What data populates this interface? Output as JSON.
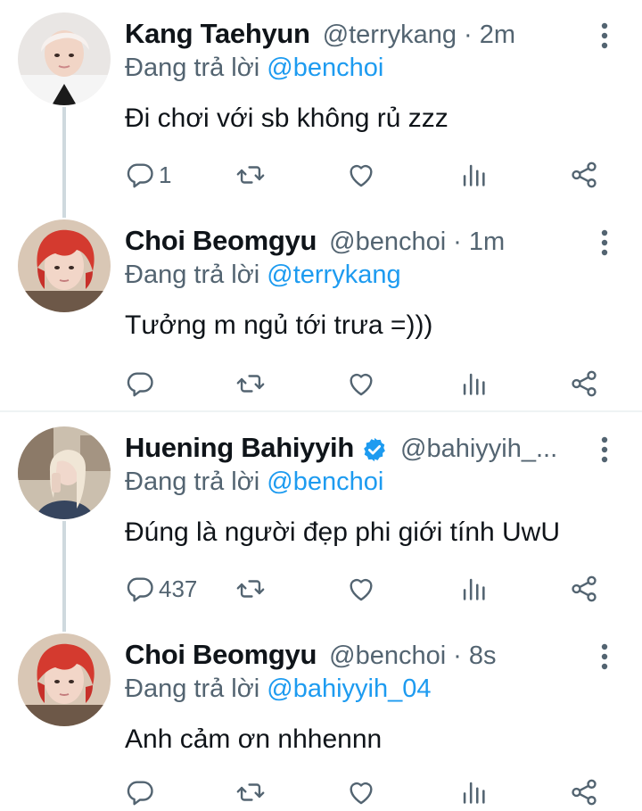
{
  "tweets": [
    {
      "name": "Kang Taehyun",
      "handle": "@terrykang",
      "time": "2m",
      "verified": false,
      "reply_prefix": "Đang trả lời",
      "reply_to": "@benchoi",
      "text": "Đi chơi với sb không rủ zzz",
      "reply_count": "1",
      "avatar": "avatar-white-hair"
    },
    {
      "name": "Choi Beomgyu",
      "handle": "@benchoi",
      "time": "1m",
      "verified": false,
      "reply_prefix": "Đang trả lời",
      "reply_to": "@terrykang",
      "text": "Tưởng m ngủ tới trưa =)))",
      "reply_count": "",
      "avatar": "avatar-red-hair"
    },
    {
      "name": "Huening Bahiyyih",
      "handle": "@bahiyyih_...",
      "time": "",
      "verified": true,
      "reply_prefix": "Đang trả lời",
      "reply_to": "@benchoi",
      "text": "Đúng là người đẹp phi giới tính UwU",
      "reply_count": "437",
      "avatar": "avatar-blonde"
    },
    {
      "name": "Choi Beomgyu",
      "handle": "@benchoi",
      "time": "8s",
      "verified": false,
      "reply_prefix": "Đang trả lời",
      "reply_to": "@bahiyyih_04",
      "text": "Anh cảm ơn nhhennn",
      "reply_count": "",
      "avatar": "avatar-red-hair"
    }
  ],
  "separator": "·",
  "colors": {
    "accent": "#1d9bf0",
    "muted": "#536471",
    "text": "#0f1419",
    "thread_line": "#cfd9de"
  },
  "icons": [
    "reply-icon",
    "retweet-icon",
    "like-icon",
    "analytics-icon",
    "share-icon",
    "more-icon",
    "verified-badge-icon"
  ]
}
